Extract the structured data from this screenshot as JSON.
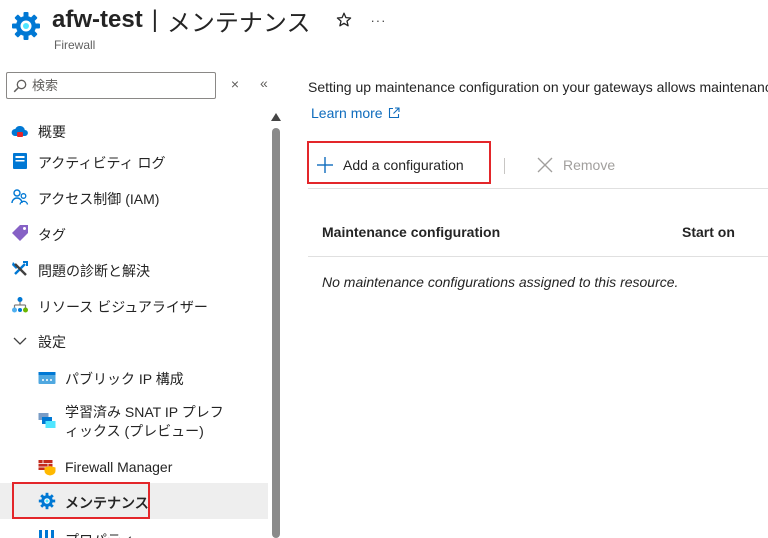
{
  "header": {
    "resource_name": "afw-test",
    "separator": "|",
    "page_name": "メンテナンス",
    "resource_type": "Firewall",
    "more_label": "···"
  },
  "sidebar": {
    "search_placeholder": "検索",
    "clear_label": "×",
    "collapse_label": "«",
    "items": [
      {
        "label": "概要",
        "icon": "cloud-icon"
      },
      {
        "label": "アクティビティ ログ",
        "icon": "activity-log-icon"
      },
      {
        "label": "アクセス制御 (IAM)",
        "icon": "people-icon"
      },
      {
        "label": "タグ",
        "icon": "tag-icon"
      },
      {
        "label": "問題の診断と解決",
        "icon": "wrench-icon"
      },
      {
        "label": "リソース ビジュアライザー",
        "icon": "hierarchy-icon"
      },
      {
        "label": "設定",
        "icon": "chevron-down-icon"
      },
      {
        "label": "パブリック IP 構成",
        "icon": "public-ip-icon"
      },
      {
        "label_line1": "学習済み SNAT IP プレフ",
        "label_line2": "ィックス (プレビュー)",
        "icon": "snat-icon"
      },
      {
        "label": "Firewall Manager",
        "icon": "firewall-manager-icon"
      },
      {
        "label": "メンテナンス",
        "icon": "gear-icon"
      },
      {
        "label": "プロパティ",
        "icon": "properties-icon"
      }
    ]
  },
  "main": {
    "description": "Setting up maintenance configuration on your gateways allows maintenance",
    "learn_more": "Learn more",
    "toolbar": {
      "add_label": "Add a configuration",
      "separator": "|",
      "remove_label": "Remove"
    },
    "table": {
      "columns": [
        "Maintenance configuration",
        "Start on"
      ],
      "empty_message": "No maintenance configurations assigned to this resource."
    }
  },
  "colors": {
    "accent": "#0f6cbd",
    "highlight": "#e3262a",
    "azure_blue": "#0078d4"
  }
}
